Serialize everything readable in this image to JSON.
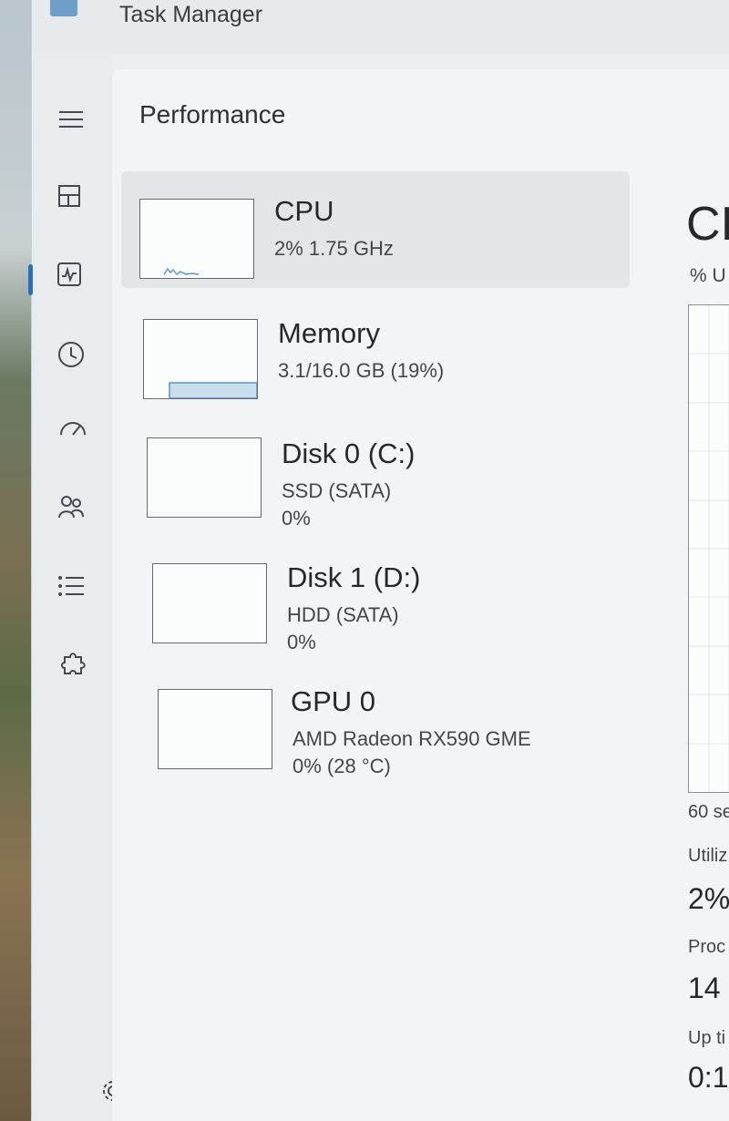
{
  "window": {
    "title": "Task Manager"
  },
  "page": {
    "title": "Performance"
  },
  "nav": {
    "items": [
      {
        "name": "menu",
        "icon": "hamburger-icon"
      },
      {
        "name": "processes",
        "icon": "processes-grid-icon"
      },
      {
        "name": "performance",
        "icon": "performance-chart-icon",
        "active": true
      },
      {
        "name": "app-history",
        "icon": "history-clock-icon"
      },
      {
        "name": "startup-apps",
        "icon": "startup-speedometer-icon"
      },
      {
        "name": "users",
        "icon": "users-icon"
      },
      {
        "name": "details",
        "icon": "details-list-icon"
      },
      {
        "name": "services",
        "icon": "services-puzzle-icon"
      }
    ],
    "settings_icon": "gear-icon"
  },
  "devices": [
    {
      "name": "CPU",
      "sub": "2% 1.75 GHz",
      "sub2": "",
      "usage_percent": 2
    },
    {
      "name": "Memory",
      "sub": "3.1/16.0 GB (19%)",
      "sub2": "",
      "usage_percent": 19
    },
    {
      "name": "Disk 0 (C:)",
      "sub": "SSD (SATA)",
      "sub2": "0%",
      "usage_percent": 0
    },
    {
      "name": "Disk 1 (D:)",
      "sub": "HDD (SATA)",
      "sub2": "0%",
      "usage_percent": 0
    },
    {
      "name": "GPU 0",
      "sub": "AMD Radeon RX590 GME",
      "sub2": "0% (28 °C)",
      "usage_percent": 0
    }
  ],
  "detail": {
    "heading": "CI",
    "unit": "% U",
    "time_label": "60 se",
    "utilization_label": "Utiliz",
    "utilization_value": "2%",
    "processes_label": "Proc",
    "processes_value": "14",
    "uptime_label": "Up ti",
    "uptime_value": "0:1"
  },
  "colors": {
    "accent": "#2c6fb3",
    "memory_fill": "#c9dff0",
    "memory_stroke": "#5c93c4"
  }
}
